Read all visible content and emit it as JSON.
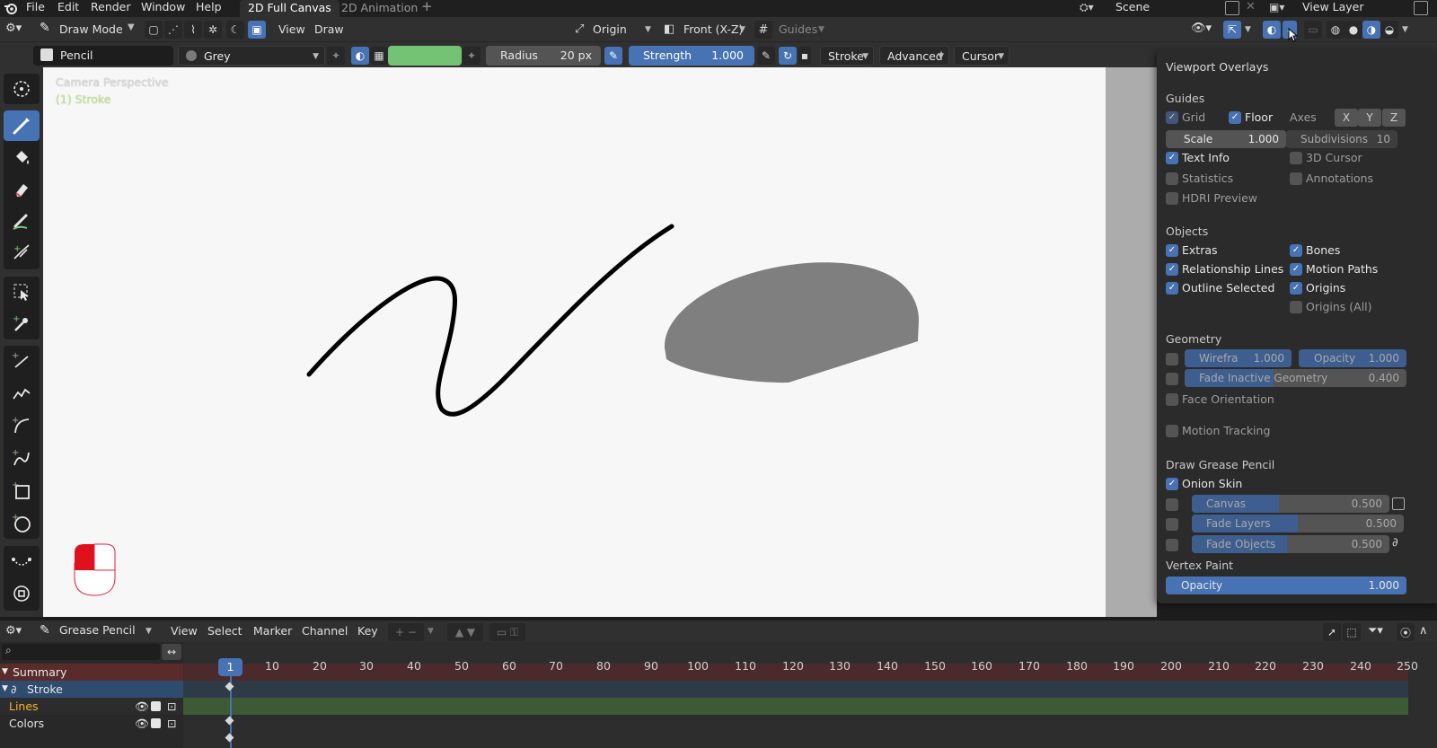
{
  "menubar": {
    "items": [
      "File",
      "Edit",
      "Render",
      "Window",
      "Help"
    ],
    "workspaces": [
      {
        "label": "2D Full Canvas",
        "active": true
      },
      {
        "label": "2D Animation",
        "active": false
      }
    ],
    "add_workspace": "+",
    "scene": "Scene",
    "view_layer": "View Layer"
  },
  "header": {
    "mode": "Draw Mode",
    "view_menu": "View",
    "draw_menu": "Draw",
    "pivot": "Origin",
    "orientation": "Front (X-Z)",
    "guides": "Guides"
  },
  "toolsettings": {
    "brush": "Pencil",
    "material": "Grey",
    "color_hex": "#74c274",
    "radius_label": "Radius",
    "radius_value": "20 px",
    "strength_label": "Strength",
    "strength_value": "1.000",
    "stroke_menu": "Stroke",
    "advanced_menu": "Advanced",
    "cursor_menu": "Cursor"
  },
  "viewport": {
    "camera_label": "Camera Perspective",
    "object_label": "(1) Stroke",
    "background": "#f7f7f7",
    "fill_color": "#7f7f7f",
    "stroke_color": "#000000"
  },
  "overlays": {
    "title": "Viewport Overlays",
    "guides": {
      "heading": "Guides",
      "grid": "Grid",
      "floor": "Floor",
      "axes": "Axes",
      "axis_x": "X",
      "axis_y": "Y",
      "axis_z": "Z",
      "scale_label": "Scale",
      "scale_value": "1.000",
      "subdivisions_label": "Subdivisions",
      "subdivisions_value": "10",
      "text_info": "Text Info",
      "cursor_3d": "3D Cursor",
      "statistics": "Statistics",
      "annotations": "Annotations",
      "hdri_preview": "HDRI Preview"
    },
    "objects": {
      "heading": "Objects",
      "extras": "Extras",
      "bones": "Bones",
      "relationship_lines": "Relationship Lines",
      "motion_paths": "Motion Paths",
      "outline_selected": "Outline Selected",
      "origins": "Origins",
      "origins_all": "Origins (All)"
    },
    "geometry": {
      "heading": "Geometry",
      "wireframe_label": "Wirefra",
      "wireframe_value": "1.000",
      "opacity_label": "Opacity",
      "opacity_value": "1.000",
      "fade_inactive_label": "Fade Inactive Geometry",
      "fade_inactive_value": "0.400",
      "fade_inactive_level": 0.4,
      "face_orientation": "Face Orientation"
    },
    "motion_tracking": "Motion Tracking",
    "draw_gp": {
      "heading": "Draw Grease Pencil",
      "onion_skin": "Onion Skin",
      "canvas_label": "Canvas",
      "canvas_value": "0.500",
      "fade_layers_label": "Fade Layers",
      "fade_layers_value": "0.500",
      "fade_objects_label": "Fade Objects",
      "fade_objects_value": "0.500"
    },
    "vertex_paint": {
      "heading": "Vertex Paint",
      "opacity_label": "Opacity",
      "opacity_value": "1.000"
    }
  },
  "timeline": {
    "mode": "Grease Pencil",
    "menus": [
      "View",
      "Select",
      "Marker",
      "Channel",
      "Key"
    ],
    "current_frame": "1",
    "ruler": [
      "10",
      "20",
      "30",
      "40",
      "50",
      "60",
      "70",
      "80",
      "90",
      "100",
      "110",
      "120",
      "130",
      "140",
      "150",
      "160",
      "170",
      "180",
      "190",
      "200",
      "210",
      "220",
      "230",
      "240",
      "250"
    ],
    "channels": {
      "summary": "Summary",
      "stroke": "Stroke",
      "lines": "Lines",
      "colors": "Colors"
    }
  }
}
